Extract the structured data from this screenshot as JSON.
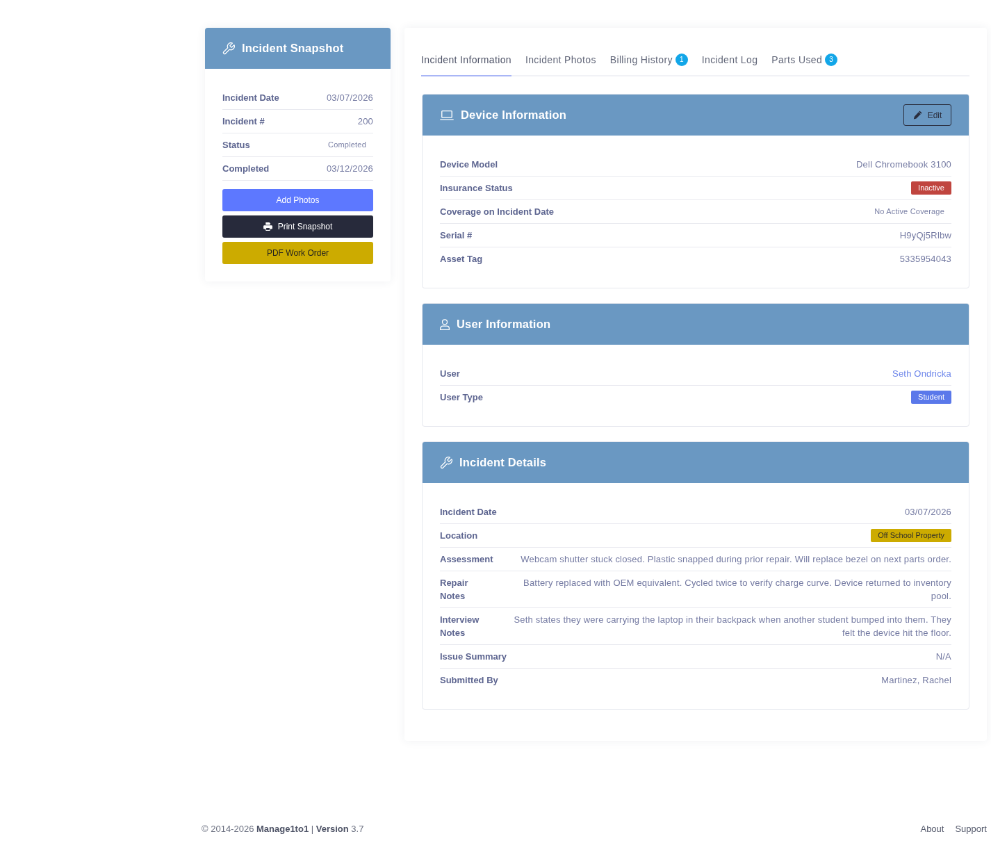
{
  "snapshot": {
    "title": "Incident Snapshot",
    "rows": [
      {
        "label": "Incident Date",
        "value": "03/07/2026",
        "kind": "text"
      },
      {
        "label": "Incident #",
        "value": "200",
        "kind": "text"
      },
      {
        "label": "Status",
        "value": "Completed",
        "kind": "note"
      },
      {
        "label": "Completed",
        "value": "03/12/2026",
        "kind": "text"
      }
    ],
    "buttons": [
      {
        "label": "Add Photos",
        "kind": "primary"
      },
      {
        "label": "Print Snapshot",
        "kind": "print"
      },
      {
        "label": "PDF Work Order",
        "kind": "accent"
      }
    ]
  },
  "tabs": [
    {
      "label": "Incident Information",
      "selected": true
    },
    {
      "label": "Incident Photos",
      "selected": false
    },
    {
      "label": "Billing History",
      "selected": false,
      "count": "1"
    },
    {
      "label": "Incident Log",
      "selected": false
    },
    {
      "label": "Parts Used",
      "selected": false,
      "count": "3"
    }
  ],
  "sections": [
    {
      "kind": "device",
      "title": "Device Information",
      "action": "Edit",
      "rows": [
        {
          "label": "Device Model",
          "value": "Dell Chromebook 3100",
          "kind": "text"
        },
        {
          "label": "Insurance Status",
          "value": "Inactive",
          "kind": "tag",
          "color": "#c0453f"
        },
        {
          "label": "Coverage on Incident Date",
          "value": "No Active Coverage",
          "kind": "note"
        },
        {
          "label": "Serial #",
          "value": "H9yQj5Rlbw",
          "kind": "text"
        },
        {
          "label": "Asset Tag",
          "value": "5335954043",
          "kind": "text"
        }
      ]
    },
    {
      "kind": "user",
      "title": "User Information",
      "rows": [
        {
          "label": "User",
          "value": "Seth Ondricka",
          "kind": "link"
        },
        {
          "label": "User Type",
          "value": "Student",
          "kind": "tag",
          "color": "#5a78ea"
        }
      ]
    },
    {
      "kind": "details",
      "title": "Incident Details",
      "rows": [
        {
          "label": "Incident Date",
          "value": "03/07/2026",
          "kind": "text"
        },
        {
          "label": "Location",
          "value": "Off School Property",
          "kind": "tag",
          "color": "#ccab00"
        },
        {
          "label": "Assessment",
          "value": "Webcam shutter stuck closed. Plastic snapped during prior repair. Will replace bezel on next parts order.",
          "kind": "text"
        },
        {
          "label": "Repair Notes",
          "value": "Battery replaced with OEM equivalent. Cycled twice to verify charge curve. Device returned to inventory pool.",
          "kind": "text"
        },
        {
          "label": "Interview Notes",
          "value": "Seth states they were carrying the laptop in their backpack when another student bumped into them. They felt the device hit the floor.",
          "kind": "text"
        },
        {
          "label": "Issue Summary",
          "value": "N/A",
          "kind": "text"
        },
        {
          "label": "Submitted By",
          "value": "Martinez, Rachel",
          "kind": "text"
        }
      ]
    }
  ],
  "footer": {
    "copyright": "© 2014-2026 **Manage1to1** | **Version** 3.7",
    "links": [
      "About",
      "Support"
    ]
  }
}
